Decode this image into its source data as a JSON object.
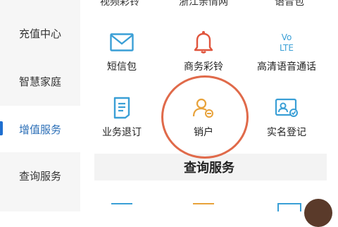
{
  "sidebar": {
    "items": [
      {
        "label": "充值中心"
      },
      {
        "label": "智慧家庭"
      },
      {
        "label": "增值服务",
        "active": true
      },
      {
        "label": "查询服务"
      }
    ]
  },
  "top_row": {
    "items": [
      "视频彩铃",
      "浙江亲情网",
      "语音包"
    ]
  },
  "tiles": [
    {
      "label": "短信包",
      "icon": "envelope-icon"
    },
    {
      "label": "商务彩铃",
      "icon": "bell-icon"
    },
    {
      "label": "高清语音通话",
      "icon": "volte-icon",
      "icon_text_top": "Vo",
      "icon_text_bottom": "LTE"
    },
    {
      "label": "业务退订",
      "icon": "document-icon"
    },
    {
      "label": "销户",
      "icon": "user-remove-icon"
    },
    {
      "label": "实名登记",
      "icon": "id-card-icon"
    }
  ],
  "section": {
    "title": "查询服务"
  },
  "colors": {
    "accent": "#2c6fb7",
    "icon_blue": "#3a9fd6",
    "icon_orange": "#e8a23a",
    "bell_red": "#e0553d",
    "highlight_circle": "#e06a4a"
  }
}
